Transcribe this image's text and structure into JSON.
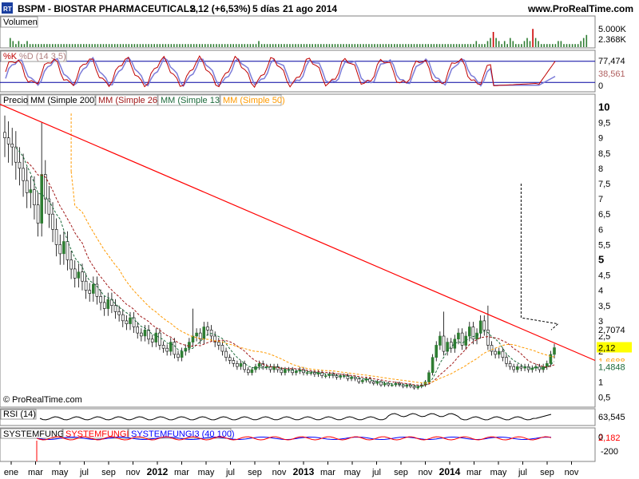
{
  "header": {
    "logo_text": "RT",
    "ticker": "BSPM - BIOSTAR PHARMACEUTICALS",
    "quote": "2,12 (+6,53%)",
    "period": "5 días",
    "date": "21 ago 2014",
    "website": "www.ProRealTime.com"
  },
  "copyright": "© ProRealTime.com",
  "colors": {
    "background": "#ffffff",
    "frame": "#808080",
    "axis_bg": "#ffffff",
    "candle_up": "#2e7d32",
    "candle_down": "#000000",
    "volume": "#2e7d32",
    "volume_down": "#cc0000",
    "trendline": "#ff0000",
    "sma26": "#a01818",
    "sma13": "#1e6b3c",
    "sma50": "#ff9a00",
    "sma200": "#000000",
    "stoch_k": "#c00000",
    "stoch_d": "#7b7bd8",
    "stoch_band": "#0000a0",
    "rsi_line": "#000000",
    "fungi1": "#000000",
    "fungi2": "#ff0000",
    "fungi3": "#0000ff",
    "highlight_last": "#ffff00"
  },
  "chart_data": [
    {
      "panel": "volume",
      "type": "bar",
      "title": "Volumen",
      "y_ticks": [
        "5.000K"
      ],
      "last_value": "2.368K",
      "description": "weekly volume bars",
      "values": [
        3,
        2,
        1,
        2,
        1,
        1,
        2,
        1,
        1,
        1,
        1,
        1,
        1,
        1,
        1,
        1,
        1,
        1,
        1,
        1,
        1,
        1,
        1,
        1,
        1,
        1,
        1,
        1,
        1,
        1,
        1,
        1,
        1,
        1,
        1,
        1,
        1,
        1,
        1,
        1,
        1,
        1,
        1,
        1,
        1,
        1,
        1,
        1,
        1,
        1,
        1,
        1,
        1,
        1,
        1,
        1,
        1,
        1,
        1,
        1,
        1,
        1,
        1,
        1,
        1,
        1,
        1,
        1,
        1,
        1,
        1,
        1,
        1,
        1,
        1,
        1,
        1,
        1,
        1,
        1,
        1,
        1,
        1,
        1,
        1,
        1,
        1,
        1,
        2,
        1,
        1,
        1,
        1,
        1,
        1,
        1,
        1,
        1,
        1,
        1,
        1,
        1,
        1,
        1,
        1,
        1,
        1,
        1,
        1,
        1,
        1,
        1,
        1,
        1,
        1,
        1,
        1,
        1,
        1,
        1,
        1,
        1,
        1,
        1,
        1,
        1,
        1,
        1,
        1,
        1,
        1,
        1,
        1,
        1,
        1,
        1,
        1,
        1,
        1,
        1,
        1,
        1,
        1,
        1,
        1,
        1,
        1,
        1,
        1,
        1,
        1,
        1,
        1,
        1,
        1,
        1,
        1,
        1,
        1,
        1,
        1,
        1,
        1,
        1,
        1,
        2,
        1,
        1,
        1,
        2,
        3,
        5,
        3,
        2,
        1,
        2,
        1,
        3,
        2,
        1,
        1,
        1,
        2,
        3,
        2,
        6,
        3,
        2,
        1,
        1,
        1,
        1,
        1,
        1,
        2,
        2,
        1,
        1,
        1,
        1,
        1,
        1,
        2,
        3,
        4
      ]
    },
    {
      "panel": "stochastic",
      "type": "line",
      "title_k": "%K",
      "title_d": "%D (14 3 5)",
      "y_ticks": [
        "0"
      ],
      "last_k": "77,474",
      "last_d": "38,561",
      "ylim": [
        0,
        100
      ],
      "band_levels": [
        80,
        20
      ]
    },
    {
      "panel": "price",
      "type": "candlestick",
      "legend": [
        "Precio",
        "MM (Simple 200)",
        "MM (Simple 26)",
        "MM (Simple 13)",
        "MM (Simple 50)"
      ],
      "y_ticks": [
        "10",
        "9,5",
        "9",
        "8,5",
        "8",
        "7,5",
        "7",
        "6,5",
        "6",
        "5,5",
        "5",
        "4,5",
        "4",
        "3,5",
        "3",
        "2,5",
        "2",
        "1,5",
        "1",
        "0,5"
      ],
      "y_tick_values": [
        10,
        9.5,
        9,
        8.5,
        8,
        7.5,
        7,
        6.5,
        6,
        5.5,
        5,
        4.5,
        4,
        3.5,
        3,
        2.5,
        2,
        1.5,
        1,
        0.5
      ],
      "ylim": [
        0.3,
        10.3
      ],
      "last_value_labels": [
        {
          "text": "2,7074",
          "value": 2.7074,
          "color": "#000000",
          "bg": "#ffffff"
        },
        {
          "text": "2,12",
          "value": 2.12,
          "color": "#000000",
          "bg": "#ffff00"
        },
        {
          "text": "1,6688",
          "value": 1.6688,
          "color": "#ff9a00",
          "bg": "#ffffff"
        },
        {
          "text": "1,4848",
          "value": 1.4848,
          "color": "#1e6b3c",
          "bg": "#ffffff"
        }
      ],
      "x_ticks": [
        "ene",
        "mar",
        "may",
        "jul",
        "sep",
        "nov",
        "2012",
        "mar",
        "may",
        "jul",
        "sep",
        "nov",
        "2013",
        "mar",
        "may",
        "jul",
        "sep",
        "nov",
        "2014",
        "mar",
        "may",
        "jul",
        "sep",
        "nov"
      ],
      "x_tick_bold": [
        "2012",
        "2013",
        "2014"
      ],
      "trendline": {
        "start": {
          "x": "2011-01",
          "y": 10.1
        },
        "end": {
          "x": "2014-11",
          "y": 1.7
        }
      },
      "close_series": [
        9.0,
        8.8,
        8.7,
        8.2,
        8.0,
        7.6,
        7.2,
        7.3,
        6.8,
        6.2,
        7.8,
        7.0,
        6.5,
        6.0,
        5.5,
        5.2,
        5.6,
        5.0,
        4.7,
        4.4,
        4.6,
        4.3,
        4.0,
        3.9,
        4.2,
        3.8,
        3.6,
        3.4,
        3.7,
        3.5,
        3.3,
        3.2,
        3.0,
        2.9,
        3.1,
        2.8,
        2.6,
        2.5,
        2.7,
        2.4,
        2.3,
        2.6,
        2.2,
        2.1,
        2.0,
        2.3,
        1.9,
        1.8,
        2.0,
        2.1,
        2.3,
        2.5,
        2.6,
        2.4,
        2.8,
        2.7,
        2.5,
        2.3,
        2.2,
        2.0,
        1.8,
        1.7,
        1.6,
        1.5,
        1.6,
        1.4,
        1.3,
        1.4,
        1.5,
        1.6,
        1.5,
        1.5,
        1.4,
        1.5,
        1.4,
        1.3,
        1.4,
        1.4,
        1.3,
        1.35,
        1.4,
        1.3,
        1.3,
        1.3,
        1.25,
        1.3,
        1.2,
        1.2,
        1.25,
        1.2,
        1.15,
        1.2,
        1.2,
        1.1,
        1.15,
        1.1,
        1.0,
        1.05,
        1.1,
        1.0,
        0.95,
        1.0,
        0.9,
        0.95,
        0.9,
        0.9,
        0.95,
        0.9,
        0.85,
        0.9,
        0.85,
        0.8,
        0.85,
        0.9,
        1.0,
        1.3,
        1.8,
        2.2,
        2.5,
        2.0,
        2.3,
        2.1,
        2.4,
        2.6,
        2.2,
        2.5,
        2.8,
        2.4,
        2.6,
        3.0,
        2.7,
        2.2,
        2.0,
        1.9,
        2.0,
        1.8,
        1.6,
        1.5,
        1.4,
        1.5,
        1.45,
        1.5,
        1.4,
        1.45,
        1.5,
        1.4,
        1.5,
        1.6,
        1.9,
        2.12
      ],
      "sma13_series_note": "dashed green following price",
      "sma26_series_note": "dashed dark red following price",
      "sma50_series_note": "dashed orange smooth"
    },
    {
      "panel": "rsi",
      "type": "line",
      "title": "RSI (14)",
      "last_value": "63,545"
    },
    {
      "panel": "systemfungi",
      "type": "line",
      "legend": [
        "SYSTEMFUNGI",
        "SYSTEMFUNGI2",
        "SYSTEMFUNGI3 (40 100)"
      ],
      "y_ticks": [
        "0",
        "-200"
      ],
      "last_value": "2,182"
    }
  ]
}
